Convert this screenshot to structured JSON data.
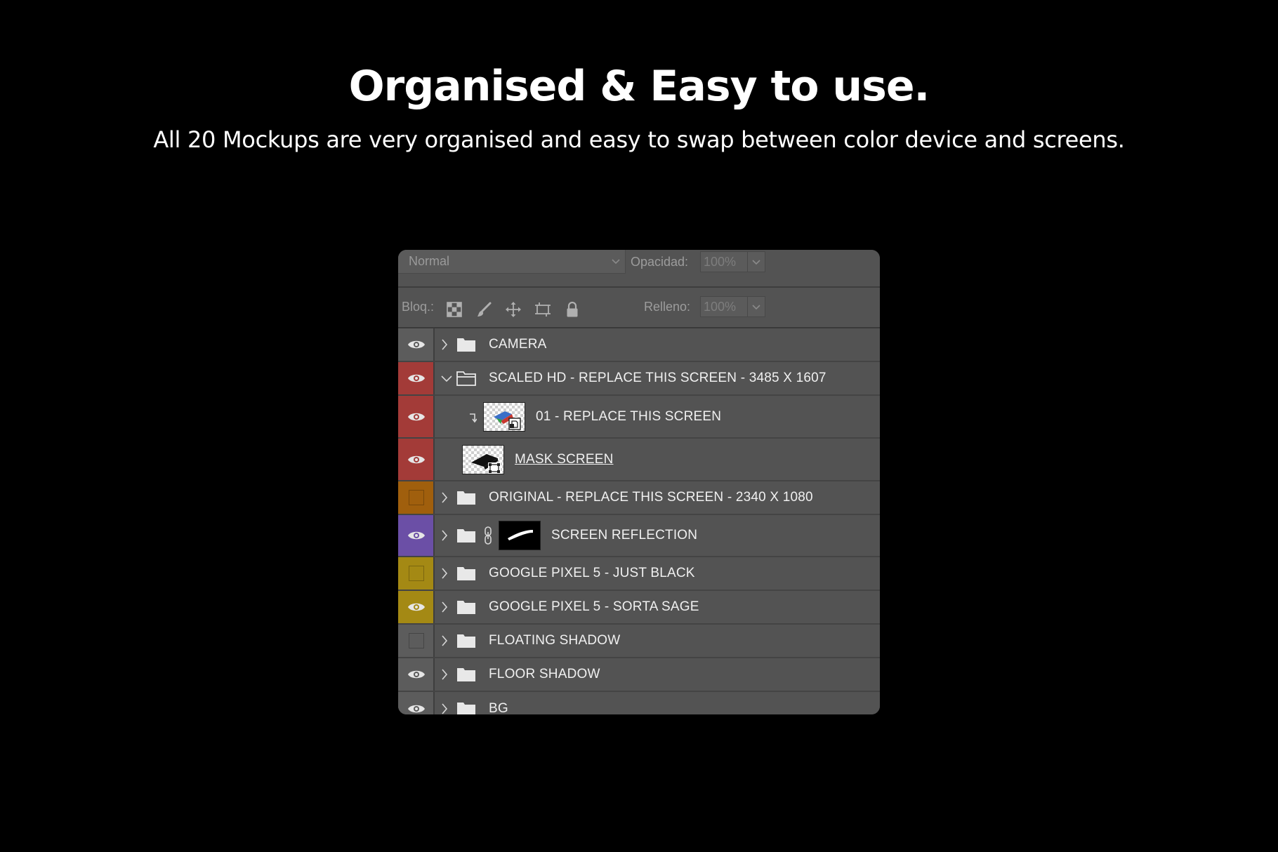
{
  "headline": "Organised & Easy to use.",
  "subline": "All 20 Mockups are very organised and easy to swap between color device and screens.",
  "options": {
    "blend_mode": "Normal",
    "opacity_label": "Opacidad:",
    "opacity_value": "100%",
    "lock_label": "Bloq.:",
    "fill_label": "Relleno:",
    "fill_value": "100%"
  },
  "colors": {
    "red": "#a33b38",
    "orange": "#a05f0d",
    "violet": "#6b4fa6",
    "yellow": "#a48914",
    "gray": "#5c5c5c",
    "eye": "#e6e6e6"
  },
  "layers": [
    {
      "name": "CAMERA",
      "visible": true,
      "tag": "gray",
      "type": "group"
    },
    {
      "name": "SCALED HD - REPLACE THIS SCREEN - 3485 X 1607",
      "visible": true,
      "tag": "red",
      "type": "group-open"
    },
    {
      "name": "01 - REPLACE THIS SCREEN",
      "visible": true,
      "tag": "red",
      "type": "smart-object-clipped"
    },
    {
      "name": "MASK SCREEN",
      "visible": true,
      "tag": "red",
      "type": "shape"
    },
    {
      "name": "ORIGINAL - REPLACE THIS SCREEN - 2340 X 1080",
      "visible": false,
      "tag": "orange",
      "type": "group"
    },
    {
      "name": "SCREEN REFLECTION",
      "visible": true,
      "tag": "violet",
      "type": "group-masked"
    },
    {
      "name": "GOOGLE PIXEL 5 - JUST BLACK",
      "visible": false,
      "tag": "yellow",
      "type": "group"
    },
    {
      "name": "GOOGLE PIXEL 5 - SORTA SAGE",
      "visible": true,
      "tag": "yellow",
      "type": "group"
    },
    {
      "name": "FLOATING SHADOW",
      "visible": false,
      "tag": "gray",
      "type": "group"
    },
    {
      "name": "FLOOR SHADOW",
      "visible": true,
      "tag": "gray",
      "type": "group"
    },
    {
      "name": "BG",
      "visible": true,
      "tag": "gray",
      "type": "group"
    }
  ]
}
